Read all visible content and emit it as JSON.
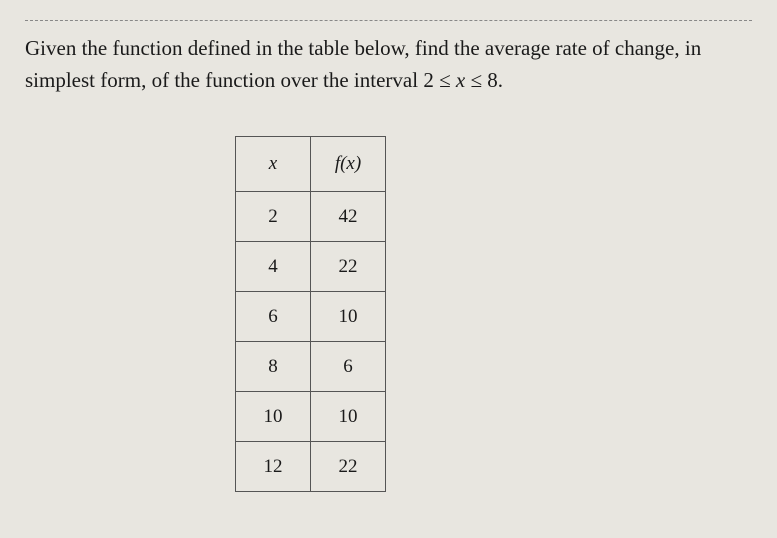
{
  "problem": {
    "line1": "Given the function defined in the table below, find the average rate of change, in",
    "line2_prefix": "simplest form, of the function over the interval ",
    "interval": "2 ≤ x ≤ 8."
  },
  "table": {
    "header_x": "x",
    "header_fx": "f(x)",
    "rows": [
      {
        "x": "2",
        "fx": "42"
      },
      {
        "x": "4",
        "fx": "22"
      },
      {
        "x": "6",
        "fx": "10"
      },
      {
        "x": "8",
        "fx": "6"
      },
      {
        "x": "10",
        "fx": "10"
      },
      {
        "x": "12",
        "fx": "22"
      }
    ]
  },
  "chart_data": {
    "type": "table",
    "title": "Function values",
    "columns": [
      "x",
      "f(x)"
    ],
    "data": [
      [
        2,
        42
      ],
      [
        4,
        22
      ],
      [
        6,
        10
      ],
      [
        8,
        6
      ],
      [
        10,
        10
      ],
      [
        12,
        22
      ]
    ]
  }
}
